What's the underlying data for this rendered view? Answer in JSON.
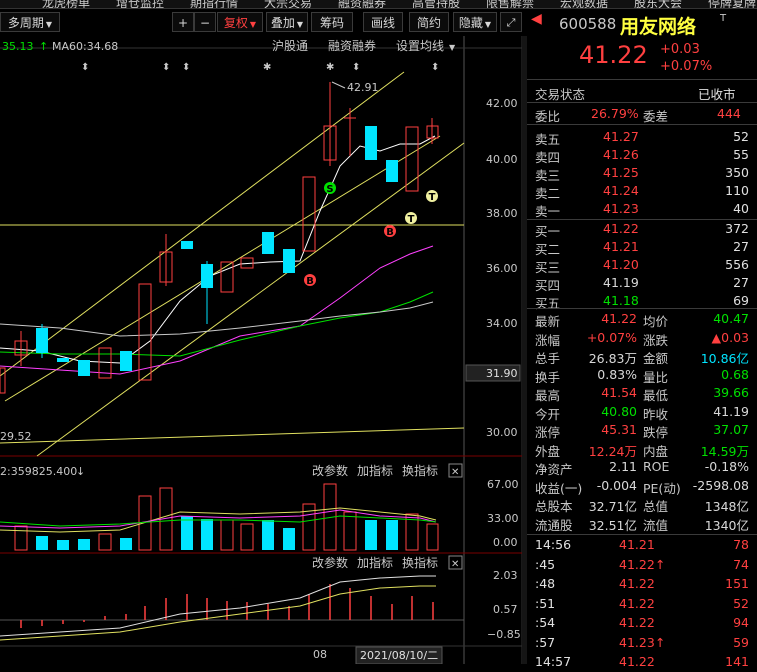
{
  "menu": [
    "龙虎榜单",
    "增仓监控",
    "期指行情",
    "大宗交易",
    "融资融券",
    "高管持股",
    "限售解禁",
    "宏观数据",
    "股东大会",
    "停牌复牌"
  ],
  "toolbar": {
    "period": "多周期",
    "plus": "+",
    "minus": "−",
    "fuquan": "复权",
    "overlay": "叠加",
    "chips": "筹码",
    "draw": "画线",
    "simple": "简约",
    "hide": "隐藏",
    "expand_icon": "expand-icon"
  },
  "ma_line": {
    "ma_value": "35.13",
    "ma_arrow": "↑",
    "ma60": "MA60:34.68",
    "links": [
      "沪股通",
      "融资融券",
      "设置均线"
    ]
  },
  "price_axis": {
    "ticks": [
      "42.00",
      "40.00",
      "38.00",
      "36.00",
      "34.00",
      "32.00",
      "30.00"
    ],
    "current": "31.90"
  },
  "annotations": {
    "high": "42.91",
    "low": "29.52"
  },
  "markers": {
    "buy": "B",
    "sell": "S",
    "t": "T"
  },
  "volume_panel": {
    "label": "2:359825.400",
    "label_arrow": "↓",
    "links": [
      "改参数",
      "加指标",
      "换指标"
    ],
    "close_icon": "✕",
    "ticks": [
      "67.00",
      "33.00",
      "0.00"
    ]
  },
  "macd_panel": {
    "links": [
      "改参数",
      "加指标",
      "换指标"
    ],
    "close_icon": "✕",
    "ticks": [
      "2.03",
      "0.57",
      "−0.85"
    ]
  },
  "x_axis": {
    "label_08": "08",
    "date": "2021/08/10/二"
  },
  "stock": {
    "code": "600588",
    "name": "用友网络",
    "badge": "T",
    "price": "41.22",
    "change": "+0.03",
    "change_pct": "+0.07%",
    "status_label": "交易状态",
    "status_value": "已收市",
    "weibi_label": "委比",
    "weibi_value": "26.79%",
    "weicha_label": "委差",
    "weicha_value": "444"
  },
  "asks": [
    {
      "label": "卖五",
      "price": "41.27",
      "vol": "52"
    },
    {
      "label": "卖四",
      "price": "41.26",
      "vol": "55"
    },
    {
      "label": "卖三",
      "price": "41.25",
      "vol": "350"
    },
    {
      "label": "卖二",
      "price": "41.24",
      "vol": "110"
    },
    {
      "label": "卖一",
      "price": "41.23",
      "vol": "40"
    }
  ],
  "bids": [
    {
      "label": "买一",
      "price": "41.22",
      "vol": "372",
      "color": "#ff4040"
    },
    {
      "label": "买二",
      "price": "41.21",
      "vol": "27",
      "color": "#ff4040"
    },
    {
      "label": "买三",
      "price": "41.20",
      "vol": "556",
      "color": "#ff4040"
    },
    {
      "label": "买四",
      "price": "41.19",
      "vol": "27",
      "color": "#d8d8d8"
    },
    {
      "label": "买五",
      "price": "41.18",
      "vol": "69",
      "color": "#00e000"
    }
  ],
  "stats": [
    {
      "l1": "最新",
      "v1": "41.22",
      "c1": "#ff4040",
      "l2": "均价",
      "v2": "40.47",
      "c2": "#00e000"
    },
    {
      "l1": "涨幅",
      "v1": "+0.07%",
      "c1": "#ff4040",
      "l2": "涨跌",
      "v2": "▲0.03",
      "c2": "#ff4040"
    },
    {
      "l1": "总手",
      "v1": "26.83万",
      "c1": "#d8d8d8",
      "l2": "金额",
      "v2": "10.86亿",
      "c2": "#00e5ff"
    },
    {
      "l1": "换手",
      "v1": "0.83%",
      "c1": "#d8d8d8",
      "l2": "量比",
      "v2": "0.68",
      "c2": "#00e000"
    },
    {
      "l1": "最高",
      "v1": "41.54",
      "c1": "#ff4040",
      "l2": "最低",
      "v2": "39.66",
      "c2": "#00e000"
    },
    {
      "l1": "今开",
      "v1": "40.80",
      "c1": "#00e000",
      "l2": "昨收",
      "v2": "41.19",
      "c2": "#d8d8d8"
    },
    {
      "l1": "涨停",
      "v1": "45.31",
      "c1": "#ff4040",
      "l2": "跌停",
      "v2": "37.07",
      "c2": "#00e000"
    },
    {
      "l1": "外盘",
      "v1": "12.24万",
      "c1": "#ff4040",
      "l2": "内盘",
      "v2": "14.59万",
      "c2": "#00e000"
    },
    {
      "l1": "净资产",
      "v1": "2.11",
      "c1": "#d8d8d8",
      "l2": "ROE",
      "v2": "-0.18%",
      "c2": "#d8d8d8"
    },
    {
      "l1": "收益(一)",
      "v1": "-0.004",
      "c1": "#d8d8d8",
      "l2": "PE(动)",
      "v2": "-2598.08",
      "c2": "#d8d8d8"
    },
    {
      "l1": "总股本",
      "v1": "32.71亿",
      "c1": "#d8d8d8",
      "l2": "总值",
      "v2": "1348亿",
      "c2": "#d8d8d8"
    },
    {
      "l1": "流通股",
      "v1": "32.51亿",
      "c1": "#d8d8d8",
      "l2": "流值",
      "v2": "1340亿",
      "c2": "#d8d8d8"
    }
  ],
  "ticks": [
    {
      "time": "14:56",
      "price": "41.21",
      "arrow": "",
      "vol": "78"
    },
    {
      "time": ":45",
      "price": "41.22",
      "arrow": "↑",
      "vol": "74"
    },
    {
      "time": ":48",
      "price": "41.22",
      "arrow": "",
      "vol": "151"
    },
    {
      "time": ":51",
      "price": "41.22",
      "arrow": "",
      "vol": "52"
    },
    {
      "time": ":54",
      "price": "41.22",
      "arrow": "",
      "vol": "94"
    },
    {
      "time": ":57",
      "price": "41.23",
      "arrow": "↑",
      "vol": "59"
    },
    {
      "time": "14:57",
      "price": "41.22",
      "arrow": "",
      "vol": "141"
    }
  ]
}
